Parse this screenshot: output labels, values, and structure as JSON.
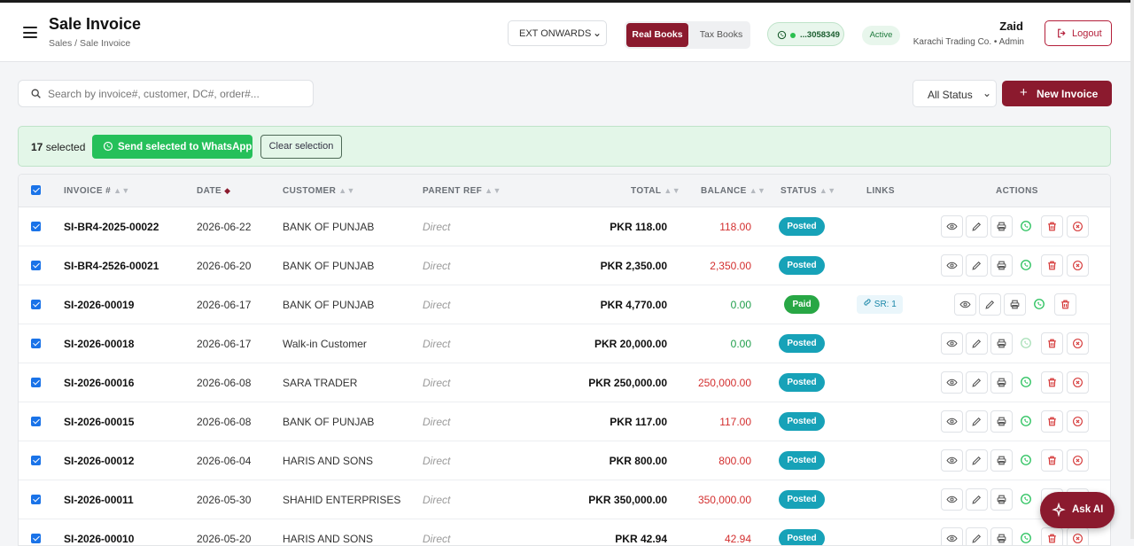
{
  "header": {
    "title": "Sale Invoice",
    "breadcrumb": "Sales / Sale Invoice",
    "company_select": "EXT ONWARDS",
    "books": {
      "real": "Real Books",
      "tax": "Tax Books"
    },
    "whatsapp_number": "...3058349",
    "status_badge": "Active",
    "user": {
      "name": "Zaid",
      "subtitle": "Karachi Trading Co. • Admin"
    },
    "logout_label": "Logout"
  },
  "toolbar": {
    "search_placeholder": "Search by invoice#, customer, DC#, order#...",
    "status_filter": "All Status",
    "new_invoice_label": "New Invoice"
  },
  "selection": {
    "count": "17",
    "count_suffix": "selected",
    "send_whatsapp_label": "Send selected to WhatsApp",
    "clear_label": "Clear selection"
  },
  "table": {
    "columns": {
      "invoice": "INVOICE #",
      "date": "DATE",
      "customer": "CUSTOMER",
      "parent_ref": "PARENT REF",
      "total": "TOTAL",
      "balance": "BALANCE",
      "status": "STATUS",
      "links": "LINKS",
      "actions": "ACTIONS"
    },
    "rows": [
      {
        "invoice": "SI-BR4-2025-00022",
        "date": "2026-06-22",
        "customer": "BANK OF PUNJAB",
        "parent_ref": "Direct",
        "total": "PKR 118.00",
        "balance": "118.00",
        "status": "Posted",
        "link": ""
      },
      {
        "invoice": "SI-BR4-2526-00021",
        "date": "2026-06-20",
        "customer": "BANK OF PUNJAB",
        "parent_ref": "Direct",
        "total": "PKR 2,350.00",
        "balance": "2,350.00",
        "status": "Posted",
        "link": ""
      },
      {
        "invoice": "SI-2026-00019",
        "date": "2026-06-17",
        "customer": "BANK OF PUNJAB",
        "parent_ref": "Direct",
        "total": "PKR 4,770.00",
        "balance": "0.00",
        "status": "Paid",
        "link": "SR: 1"
      },
      {
        "invoice": "SI-2026-00018",
        "date": "2026-06-17",
        "customer": "Walk-in Customer",
        "parent_ref": "Direct",
        "total": "PKR 20,000.00",
        "balance": "0.00",
        "status": "Posted",
        "link": ""
      },
      {
        "invoice": "SI-2026-00016",
        "date": "2026-06-08",
        "customer": "SARA TRADER",
        "parent_ref": "Direct",
        "total": "PKR 250,000.00",
        "balance": "250,000.00",
        "status": "Posted",
        "link": ""
      },
      {
        "invoice": "SI-2026-00015",
        "date": "2026-06-08",
        "customer": "BANK OF PUNJAB",
        "parent_ref": "Direct",
        "total": "PKR 117.00",
        "balance": "117.00",
        "status": "Posted",
        "link": ""
      },
      {
        "invoice": "SI-2026-00012",
        "date": "2026-06-04",
        "customer": "HARIS AND SONS",
        "parent_ref": "Direct",
        "total": "PKR 800.00",
        "balance": "800.00",
        "status": "Posted",
        "link": ""
      },
      {
        "invoice": "SI-2026-00011",
        "date": "2026-05-30",
        "customer": "SHAHID ENTERPRISES",
        "parent_ref": "Direct",
        "total": "PKR 350,000.00",
        "balance": "350,000.00",
        "status": "Posted",
        "link": ""
      },
      {
        "invoice": "SI-2026-00010",
        "date": "2026-05-20",
        "customer": "HARIS AND SONS",
        "parent_ref": "Direct",
        "total": "PKR 42.94",
        "balance": "42.94",
        "status": "Posted",
        "link": ""
      }
    ]
  },
  "ask_ai_label": "Ask AI",
  "colors": {
    "brand": "#8b1a2e",
    "posted": "#17a2b8",
    "paid": "#28a745",
    "balance_due": "#d32f2f",
    "balance_zero": "#1e9e4a",
    "whatsapp": "#25c05a"
  }
}
